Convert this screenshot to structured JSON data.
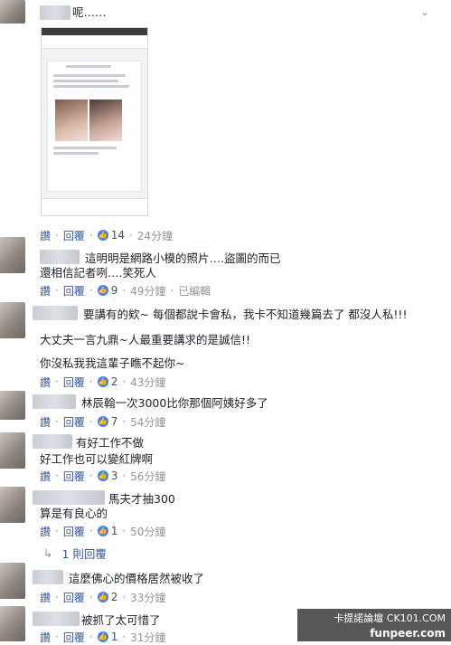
{
  "comments": [
    {
      "lines": [
        "呢……"
      ],
      "actions": {
        "like": "讚",
        "reply": "回覆",
        "likes": "14",
        "time": "24分鐘"
      }
    },
    {
      "lines": [
        "這明明是網路小模的照片….盜圖的而已",
        "還相信記者咧….笑死人"
      ],
      "actions": {
        "like": "讚",
        "reply": "回覆",
        "likes": "9",
        "time": "49分鐘",
        "edited": "已編輯"
      }
    },
    {
      "lines": [
        "要講有的欸~ 每個都說卡會私，我卡不知道幾篇去了 都沒人私!!!",
        "大丈夫一言九鼎~人最重要講求的是誠信!!",
        "你沒私我我這輩子瞧不起你~"
      ],
      "actions": {
        "like": "讚",
        "reply": "回覆",
        "likes": "2",
        "time": "43分鐘"
      }
    },
    {
      "lines": [
        "林辰翰一次3000比你那個阿姨好多了"
      ],
      "actions": {
        "like": "讚",
        "reply": "回覆",
        "likes": "7",
        "time": "54分鐘"
      }
    },
    {
      "lines": [
        "有好工作不做",
        "好工作也可以變紅牌啊"
      ],
      "actions": {
        "like": "讚",
        "reply": "回覆",
        "likes": "3",
        "time": "56分鐘"
      }
    },
    {
      "lines": [
        "馬夫才抽300",
        "算是有良心的"
      ],
      "actions": {
        "like": "讚",
        "reply": "回覆",
        "likes": "1",
        "time": "50分鐘"
      }
    },
    {
      "lines": [
        "這麼佛心的價格居然被收了"
      ],
      "actions": {
        "like": "讚",
        "reply": "回覆",
        "likes": "2",
        "time": "33分鐘"
      }
    },
    {
      "lines": [
        "被抓了太可惜了"
      ],
      "actions": {
        "like": "讚",
        "reply": "回覆",
        "likes": "1",
        "time": "31分鐘"
      }
    }
  ],
  "reply_thread": {
    "label": "1 則回覆"
  },
  "watermark": {
    "line1": "卡提諾論壇 CK101.COM",
    "line2": "funpeer.com"
  }
}
